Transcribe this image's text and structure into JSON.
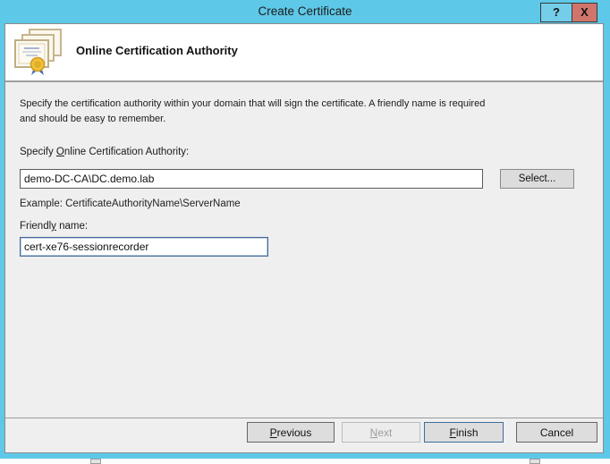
{
  "window": {
    "title": "Create Certificate",
    "help_button": "?",
    "close_button": "X",
    "accent_color": "#5ec8e8",
    "close_color": "#d0756c"
  },
  "header": {
    "title": "Online Certification Authority",
    "icon": "certificates-icon"
  },
  "body": {
    "description_line1": "Specify the certification authority within your domain that will sign the certificate. A friendly name is required",
    "description_line2": "and should be easy to remember.",
    "ca_label": {
      "pre": "Specify ",
      "key": "O",
      "post": "nline Certification Authority:"
    },
    "ca_value": "demo-DC-CA\\DC.demo.lab",
    "select_button": "Select...",
    "example": "Example: CertificateAuthorityName\\ServerName",
    "friendly_label": {
      "pre": "Friendl",
      "key": "y",
      "post": " name:"
    },
    "friendly_value": "cert-xe76-sessionrecorder"
  },
  "footer": {
    "previous": {
      "pre": "",
      "key": "P",
      "post": "revious"
    },
    "next": {
      "pre": "",
      "key": "N",
      "post": "ext"
    },
    "finish": {
      "pre": "",
      "key": "F",
      "post": "inish"
    },
    "cancel": {
      "pre": "Cancel",
      "key": "",
      "post": ""
    }
  }
}
